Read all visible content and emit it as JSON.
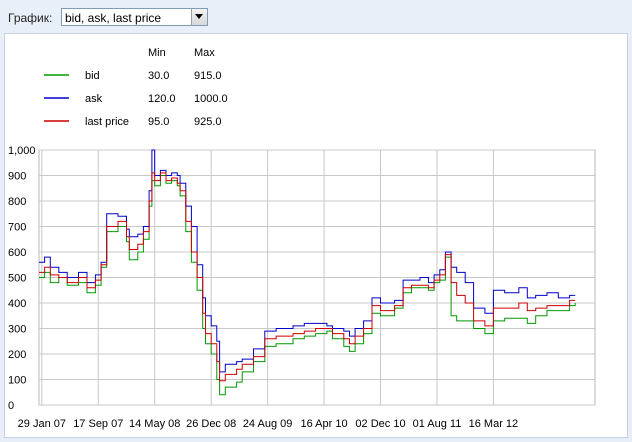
{
  "selector": {
    "label": "График:",
    "value": "bid, ask, last price"
  },
  "legend": {
    "min_header": "Min",
    "max_header": "Max",
    "rows": [
      {
        "name": "bid",
        "min": "30.0",
        "max": "915.0",
        "color": "#009900"
      },
      {
        "name": "ask",
        "min": "120.0",
        "max": "1000.0",
        "color": "#0000cc"
      },
      {
        "name": "last price",
        "min": "95.0",
        "max": "925.0",
        "color": "#cc0000"
      }
    ]
  },
  "chart_data": {
    "type": "line",
    "y_ticks": [
      "1,000",
      "900",
      "800",
      "700",
      "600",
      "500",
      "400",
      "300",
      "200",
      "100",
      "0"
    ],
    "x_ticks": [
      "29 Jan 07",
      "17 Sep 07",
      "14 May 08",
      "26 Dec 08",
      "24 Aug 09",
      "16 Apr 10",
      "02 Dec 10",
      "01 Aug 11",
      "16 Mar 12"
    ],
    "ylim": [
      0,
      1000
    ],
    "xlim": [
      0,
      9.85
    ],
    "grid": true,
    "series": [
      {
        "name": "bid",
        "color": "#009900",
        "points": [
          [
            0.0,
            500
          ],
          [
            0.1,
            520
          ],
          [
            0.2,
            480
          ],
          [
            0.35,
            500
          ],
          [
            0.5,
            470
          ],
          [
            0.7,
            480
          ],
          [
            0.85,
            440
          ],
          [
            1.0,
            470
          ],
          [
            1.1,
            540
          ],
          [
            1.2,
            680
          ],
          [
            1.4,
            700
          ],
          [
            1.55,
            640
          ],
          [
            1.6,
            570
          ],
          [
            1.75,
            600
          ],
          [
            1.85,
            650
          ],
          [
            1.95,
            780
          ],
          [
            2.0,
            880
          ],
          [
            2.05,
            860
          ],
          [
            2.15,
            900
          ],
          [
            2.25,
            870
          ],
          [
            2.35,
            880
          ],
          [
            2.45,
            860
          ],
          [
            2.5,
            820
          ],
          [
            2.6,
            680
          ],
          [
            2.7,
            560
          ],
          [
            2.8,
            450
          ],
          [
            2.9,
            300
          ],
          [
            2.95,
            240
          ],
          [
            3.05,
            200
          ],
          [
            3.15,
            100
          ],
          [
            3.2,
            40
          ],
          [
            3.3,
            70
          ],
          [
            3.5,
            90
          ],
          [
            3.6,
            130
          ],
          [
            3.8,
            170
          ],
          [
            4.0,
            230
          ],
          [
            4.2,
            240
          ],
          [
            4.5,
            260
          ],
          [
            4.7,
            270
          ],
          [
            4.9,
            280
          ],
          [
            5.1,
            290
          ],
          [
            5.2,
            260
          ],
          [
            5.4,
            230
          ],
          [
            5.5,
            210
          ],
          [
            5.6,
            240
          ],
          [
            5.75,
            280
          ],
          [
            5.9,
            360
          ],
          [
            6.05,
            350
          ],
          [
            6.3,
            380
          ],
          [
            6.45,
            440
          ],
          [
            6.6,
            460
          ],
          [
            6.75,
            460
          ],
          [
            6.9,
            450
          ],
          [
            7.0,
            480
          ],
          [
            7.1,
            490
          ],
          [
            7.2,
            580
          ],
          [
            7.3,
            350
          ],
          [
            7.4,
            330
          ],
          [
            7.55,
            330
          ],
          [
            7.7,
            300
          ],
          [
            7.9,
            280
          ],
          [
            8.05,
            330
          ],
          [
            8.25,
            340
          ],
          [
            8.5,
            340
          ],
          [
            8.65,
            320
          ],
          [
            8.8,
            350
          ],
          [
            9.0,
            370
          ],
          [
            9.2,
            370
          ],
          [
            9.4,
            390
          ],
          [
            9.5,
            400
          ]
        ]
      },
      {
        "name": "ask",
        "color": "#0000cc",
        "points": [
          [
            0.0,
            560
          ],
          [
            0.1,
            580
          ],
          [
            0.2,
            540
          ],
          [
            0.35,
            520
          ],
          [
            0.5,
            500
          ],
          [
            0.7,
            520
          ],
          [
            0.85,
            480
          ],
          [
            1.0,
            510
          ],
          [
            1.1,
            560
          ],
          [
            1.2,
            750
          ],
          [
            1.4,
            740
          ],
          [
            1.55,
            690
          ],
          [
            1.6,
            660
          ],
          [
            1.75,
            670
          ],
          [
            1.85,
            700
          ],
          [
            1.95,
            840
          ],
          [
            2.0,
            1000
          ],
          [
            2.05,
            900
          ],
          [
            2.15,
            920
          ],
          [
            2.25,
            900
          ],
          [
            2.35,
            910
          ],
          [
            2.45,
            900
          ],
          [
            2.5,
            870
          ],
          [
            2.6,
            780
          ],
          [
            2.7,
            700
          ],
          [
            2.8,
            550
          ],
          [
            2.9,
            420
          ],
          [
            2.95,
            350
          ],
          [
            3.05,
            310
          ],
          [
            3.15,
            250
          ],
          [
            3.2,
            130
          ],
          [
            3.3,
            160
          ],
          [
            3.5,
            170
          ],
          [
            3.6,
            180
          ],
          [
            3.8,
            220
          ],
          [
            4.0,
            290
          ],
          [
            4.2,
            300
          ],
          [
            4.5,
            310
          ],
          [
            4.7,
            320
          ],
          [
            4.9,
            320
          ],
          [
            5.1,
            310
          ],
          [
            5.2,
            300
          ],
          [
            5.4,
            290
          ],
          [
            5.5,
            270
          ],
          [
            5.6,
            300
          ],
          [
            5.75,
            330
          ],
          [
            5.9,
            420
          ],
          [
            6.05,
            400
          ],
          [
            6.3,
            410
          ],
          [
            6.45,
            490
          ],
          [
            6.6,
            490
          ],
          [
            6.75,
            500
          ],
          [
            6.9,
            480
          ],
          [
            7.0,
            510
          ],
          [
            7.1,
            530
          ],
          [
            7.2,
            600
          ],
          [
            7.3,
            540
          ],
          [
            7.4,
            520
          ],
          [
            7.55,
            480
          ],
          [
            7.7,
            380
          ],
          [
            7.9,
            360
          ],
          [
            8.05,
            450
          ],
          [
            8.25,
            440
          ],
          [
            8.5,
            460
          ],
          [
            8.65,
            420
          ],
          [
            8.8,
            430
          ],
          [
            9.0,
            440
          ],
          [
            9.2,
            420
          ],
          [
            9.4,
            430
          ],
          [
            9.5,
            430
          ]
        ]
      },
      {
        "name": "last price",
        "color": "#cc0000",
        "points": [
          [
            0.0,
            520
          ],
          [
            0.1,
            540
          ],
          [
            0.2,
            510
          ],
          [
            0.35,
            500
          ],
          [
            0.5,
            480
          ],
          [
            0.7,
            500
          ],
          [
            0.85,
            460
          ],
          [
            1.0,
            490
          ],
          [
            1.1,
            550
          ],
          [
            1.2,
            700
          ],
          [
            1.4,
            720
          ],
          [
            1.55,
            660
          ],
          [
            1.6,
            610
          ],
          [
            1.75,
            630
          ],
          [
            1.85,
            680
          ],
          [
            1.95,
            800
          ],
          [
            2.0,
            910
          ],
          [
            2.05,
            880
          ],
          [
            2.15,
            910
          ],
          [
            2.25,
            880
          ],
          [
            2.35,
            890
          ],
          [
            2.45,
            870
          ],
          [
            2.5,
            840
          ],
          [
            2.6,
            720
          ],
          [
            2.7,
            600
          ],
          [
            2.8,
            500
          ],
          [
            2.9,
            360
          ],
          [
            2.95,
            280
          ],
          [
            3.05,
            240
          ],
          [
            3.15,
            170
          ],
          [
            3.2,
            95
          ],
          [
            3.3,
            120
          ],
          [
            3.5,
            140
          ],
          [
            3.6,
            160
          ],
          [
            3.8,
            190
          ],
          [
            4.0,
            260
          ],
          [
            4.2,
            270
          ],
          [
            4.5,
            280
          ],
          [
            4.7,
            290
          ],
          [
            4.9,
            300
          ],
          [
            5.1,
            300
          ],
          [
            5.2,
            280
          ],
          [
            5.4,
            260
          ],
          [
            5.5,
            240
          ],
          [
            5.6,
            270
          ],
          [
            5.75,
            300
          ],
          [
            5.9,
            390
          ],
          [
            6.05,
            370
          ],
          [
            6.3,
            390
          ],
          [
            6.45,
            460
          ],
          [
            6.6,
            470
          ],
          [
            6.75,
            470
          ],
          [
            6.9,
            460
          ],
          [
            7.0,
            490
          ],
          [
            7.1,
            510
          ],
          [
            7.2,
            590
          ],
          [
            7.3,
            480
          ],
          [
            7.4,
            430
          ],
          [
            7.55,
            400
          ],
          [
            7.7,
            330
          ],
          [
            7.9,
            310
          ],
          [
            8.05,
            380
          ],
          [
            8.25,
            380
          ],
          [
            8.5,
            400
          ],
          [
            8.65,
            370
          ],
          [
            8.8,
            380
          ],
          [
            9.0,
            390
          ],
          [
            9.2,
            390
          ],
          [
            9.4,
            410
          ],
          [
            9.5,
            410
          ]
        ]
      }
    ]
  }
}
